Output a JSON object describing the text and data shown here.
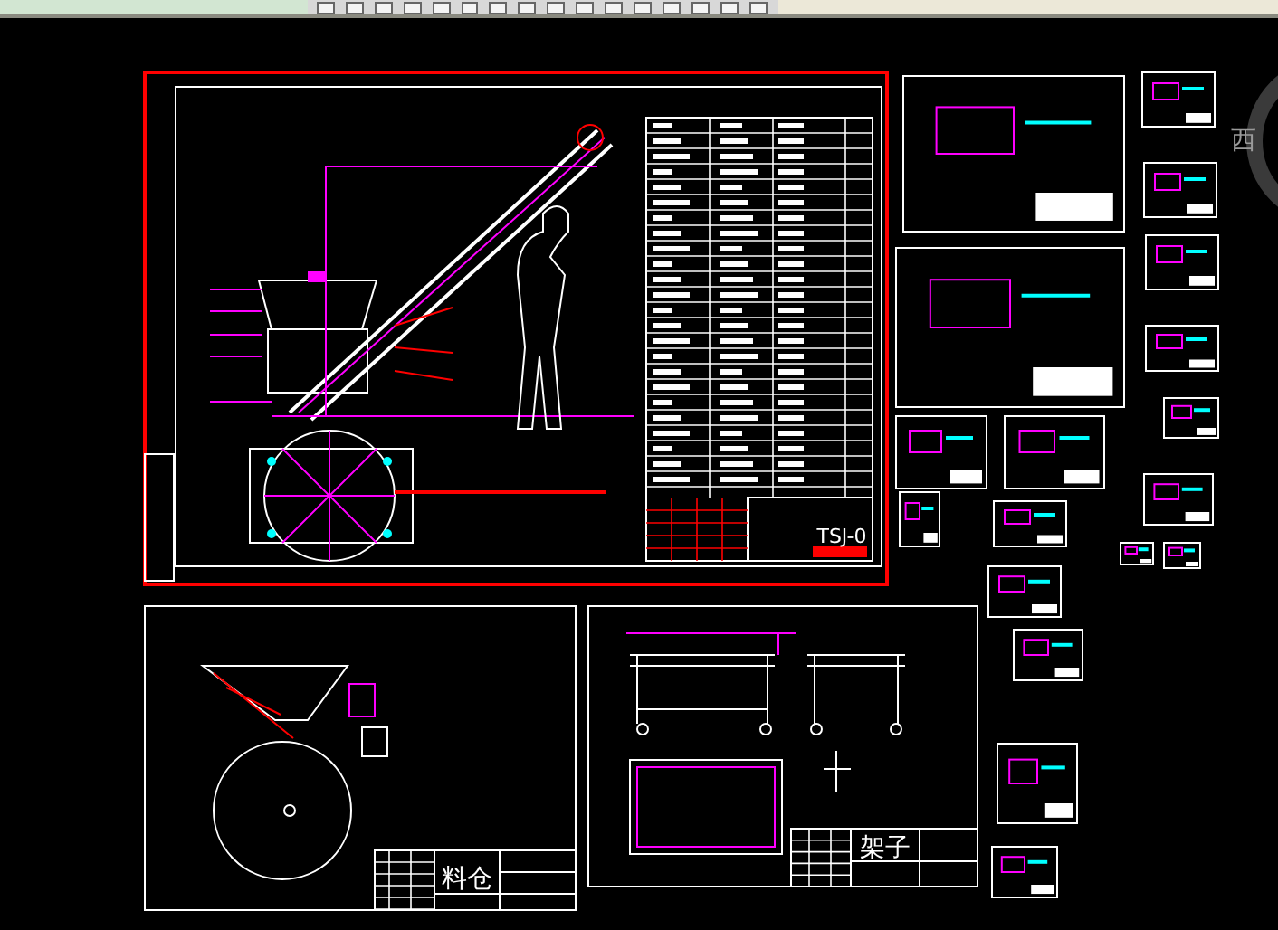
{
  "drawings": [
    {
      "kind": "assembly",
      "title": "TSJ-0"
    },
    {
      "kind": "hopper",
      "title": "料仓"
    },
    {
      "kind": "frame",
      "title": "架子"
    }
  ],
  "compass": {
    "direction": "西"
  }
}
